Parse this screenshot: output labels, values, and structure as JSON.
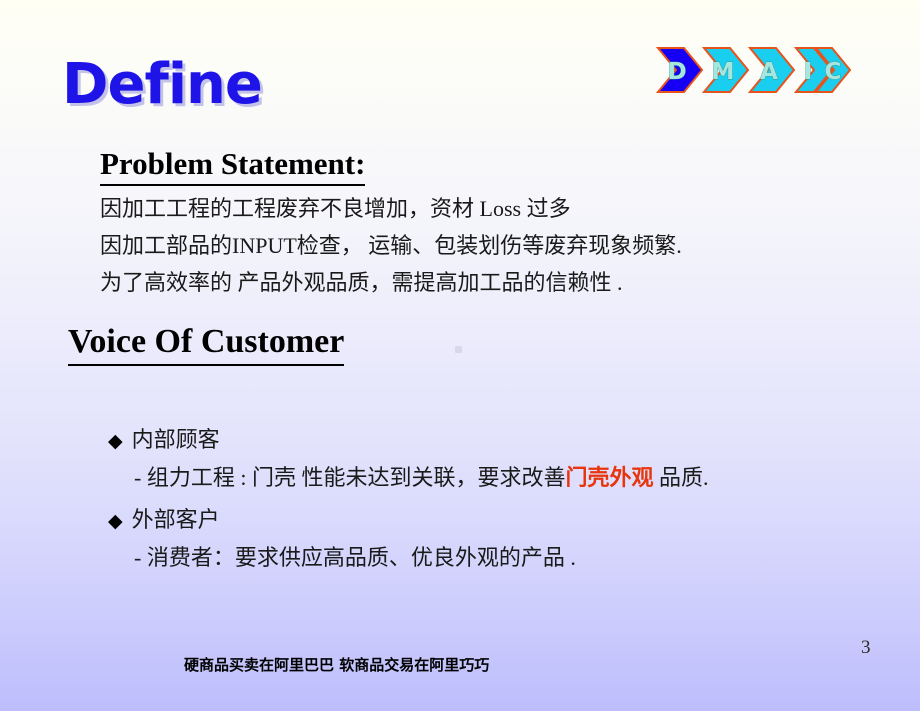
{
  "slide": {
    "title": "Define",
    "page_number": "3",
    "footer": "硬商品买卖在阿里巴巴  软商品交易在阿里巧巧",
    "background": {
      "top_color": "#fffff4",
      "bottom_color": "#bdbdfd"
    }
  },
  "logo": {
    "name": "dmaic-phase-logo",
    "active_index": 0,
    "active_color": "#1500f5",
    "inactive_color": "#19ceef",
    "border_color": "#e8531c",
    "letter_color": "#a5e6de",
    "steps": [
      {
        "label": "D"
      },
      {
        "label": "M"
      },
      {
        "label": "A"
      },
      {
        "label": "I"
      },
      {
        "label": "C"
      }
    ]
  },
  "problem_statement": {
    "heading": "Problem Statement:",
    "lines": [
      "因加工工程的工程废弃不良增加，资材 Loss 过多",
      "因加工部品的INPUT检查， 运输、包装划伤等废弃现象频繁.",
      "为了高效率的 产品外观品质，需提高加工品的信赖性 ."
    ]
  },
  "voice_of_customer": {
    "heading": "Voice Of Customer",
    "bullets": [
      {
        "marker": "◆",
        "label": "内部顾客",
        "detail_prefix": "- 组力工程 : 门壳 性能未达到关联，要求改善",
        "detail_emphasis": "门壳外观",
        "detail_suffix": " 品质.",
        "emphasis_color": "#e8350d"
      },
      {
        "marker": "◆",
        "label": "外部客户",
        "detail_prefix": "- 消费者：要求供应高品质、优良外观的产品 .",
        "detail_emphasis": "",
        "detail_suffix": "",
        "emphasis_color": "#e8350d"
      }
    ]
  }
}
